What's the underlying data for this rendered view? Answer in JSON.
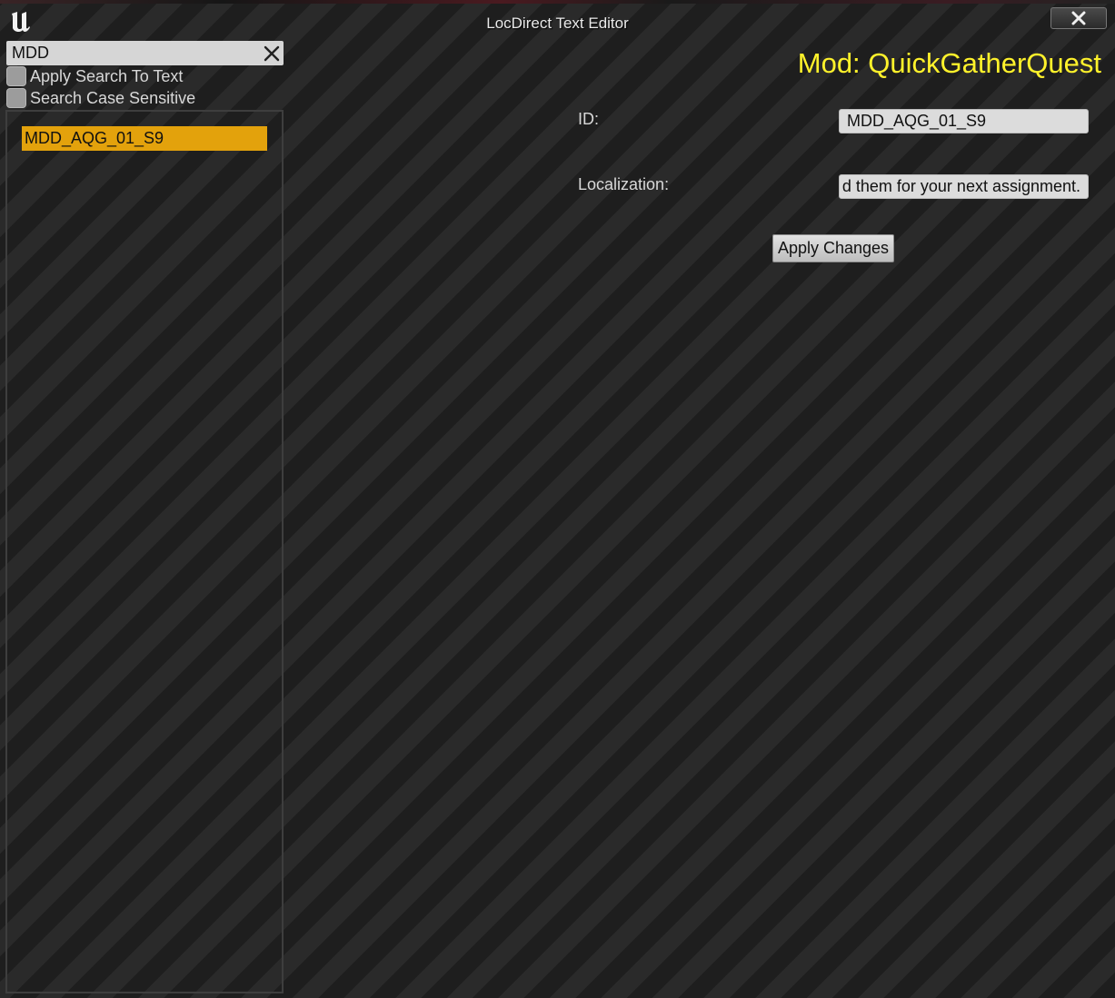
{
  "window": {
    "title": "LocDirect Text Editor"
  },
  "search": {
    "value": "MDD",
    "apply_to_text_label": "Apply Search To Text",
    "apply_to_text_checked": false,
    "case_sensitive_label": "Search Case Sensitive",
    "case_sensitive_checked": false
  },
  "list": {
    "items": [
      {
        "label": "MDD_AQG_01_S9",
        "selected": true
      }
    ]
  },
  "editor": {
    "mod_title": "Mod: QuickGatherQuest",
    "id_label": "ID:",
    "id_value": "MDD_AQG_01_S9",
    "localization_label": "Localization:",
    "localization_value": "d them for your next assignment.",
    "apply_button": "Apply Changes"
  },
  "colors": {
    "accent_selected": "#e3a20c",
    "mod_title": "#fff22b"
  },
  "icons": {
    "logo": "unreal-engine-logo-icon",
    "close": "close-icon",
    "clear": "clear-search-icon"
  }
}
